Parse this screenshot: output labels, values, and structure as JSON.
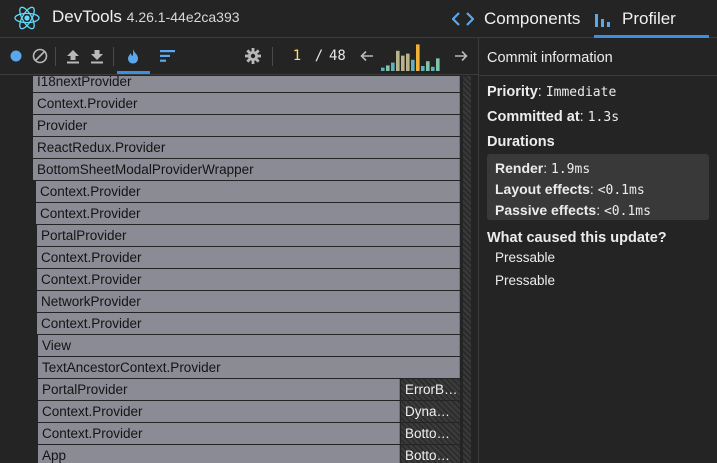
{
  "header": {
    "title": "DevTools",
    "version": "4.26.1-44e2ca393",
    "tabs": [
      {
        "label": "Components",
        "icon": "code-brackets-icon"
      },
      {
        "label": "Profiler",
        "icon": "bar-chart-icon",
        "active": true
      }
    ]
  },
  "toolbar": {
    "commit_current": "1",
    "commit_separator": "/",
    "commit_total": "48",
    "commit_bar_levels": [
      0.12,
      0.2,
      0.3,
      0.72,
      0.55,
      0.62,
      0.4,
      0.95,
      0.18,
      0.35,
      0.15,
      0.45
    ],
    "selected_commit_index": 7,
    "accent_color": "#3d8fe0",
    "highlight_color": "#ffe066"
  },
  "flamegraph": {
    "rows": [
      {
        "label": "I18nextProvider"
      },
      {
        "label": "Context.Provider"
      },
      {
        "label": "Provider"
      },
      {
        "label": "ReactRedux.Provider"
      },
      {
        "label": "BottomSheetModalProviderWrapper"
      },
      {
        "label": "Context.Provider"
      },
      {
        "label": "Context.Provider"
      },
      {
        "label": "PortalProvider"
      },
      {
        "label": "Context.Provider"
      },
      {
        "label": "Context.Provider"
      },
      {
        "label": "NetworkProvider"
      },
      {
        "label": "Context.Provider"
      },
      {
        "label": "View"
      },
      {
        "label": "TextAncestorContext.Provider"
      },
      {
        "label": "PortalProvider",
        "side": "ErrorB…"
      },
      {
        "label": "Context.Provider",
        "side": "Dyna…"
      },
      {
        "label": "Context.Provider",
        "side": "Botto…"
      },
      {
        "label": "App",
        "side": "Botto…"
      }
    ]
  },
  "info": {
    "title": "Commit information",
    "priority_label": "Priority",
    "priority_value": "Immediate",
    "committed_label": "Committed at",
    "committed_value": "1.3s",
    "durations_label": "Durations",
    "render_label": "Render",
    "render_value": "1.9ms",
    "layout_label": "Layout effects",
    "layout_value": "<0.1ms",
    "passive_label": "Passive effects",
    "passive_value": "<0.1ms",
    "cause_label": "What caused this update?",
    "causes": [
      "Pressable",
      "Pressable"
    ]
  }
}
